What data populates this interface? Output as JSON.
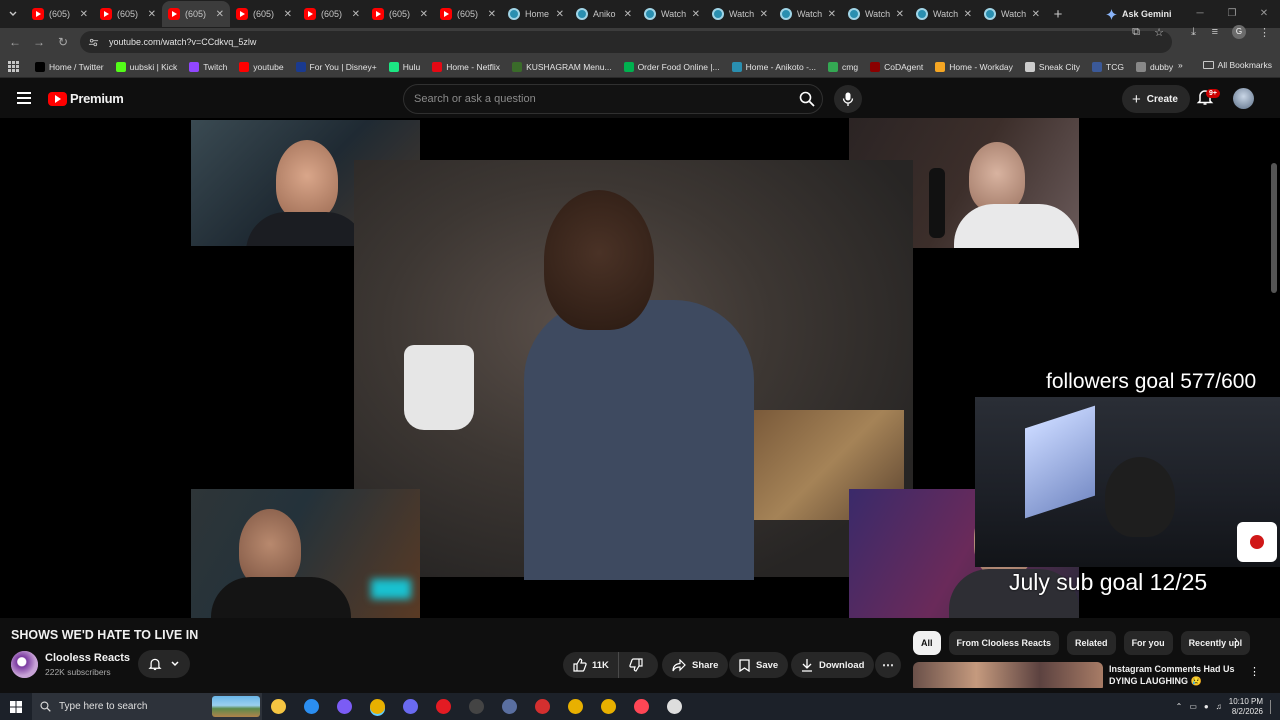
{
  "browser": {
    "tabs": [
      {
        "label": "(605)",
        "icon": "youtube-icon",
        "active": false
      },
      {
        "label": "(605)",
        "icon": "youtube-icon",
        "active": false
      },
      {
        "label": "(605)",
        "icon": "youtube-icon",
        "active": true
      },
      {
        "label": "(605)",
        "icon": "youtube-icon",
        "active": false
      },
      {
        "label": "(605)",
        "icon": "youtube-icon",
        "active": false
      },
      {
        "label": "(605)",
        "icon": "youtube-icon",
        "active": false
      },
      {
        "label": "(605)",
        "icon": "youtube-icon",
        "active": false
      },
      {
        "label": "Home",
        "icon": "globe-icon",
        "active": false
      },
      {
        "label": "Aniko",
        "icon": "globe-icon",
        "active": false
      },
      {
        "label": "Watch",
        "icon": "globe-icon",
        "active": false
      },
      {
        "label": "Watch",
        "icon": "globe-icon",
        "active": false
      },
      {
        "label": "Watch",
        "icon": "globe-icon",
        "active": false
      },
      {
        "label": "Watch",
        "icon": "globe-icon",
        "active": false
      },
      {
        "label": "Watch",
        "icon": "globe-icon",
        "active": false
      },
      {
        "label": "Watch",
        "icon": "globe-icon",
        "active": false
      }
    ],
    "ask_gemini": "Ask Gemini",
    "url": "youtube.com/watch?v=CCdkvq_5zlw",
    "bookmarks": [
      {
        "label": "Home / Twitter",
        "color": "#000000"
      },
      {
        "label": "uubski | Kick",
        "color": "#53fc18"
      },
      {
        "label": "Twitch",
        "color": "#9146ff"
      },
      {
        "label": "youtube",
        "color": "#ff0000"
      },
      {
        "label": "For You | Disney+",
        "color": "#1a3a8f"
      },
      {
        "label": "Hulu",
        "color": "#1ce783"
      },
      {
        "label": "Home - Netflix",
        "color": "#e50914"
      },
      {
        "label": "KUSHAGRAM Menu...",
        "color": "#3a6b2a"
      },
      {
        "label": "Order Food Online |...",
        "color": "#00b14f"
      },
      {
        "label": "Home - Anikoto -...",
        "color": "#2a8fb0"
      },
      {
        "label": "cmg",
        "color": "#34a853"
      },
      {
        "label": "CoDAgent",
        "color": "#8b0000"
      },
      {
        "label": "Home - Workday",
        "color": "#f5a623"
      },
      {
        "label": "Sneak City",
        "color": "#cccccc"
      },
      {
        "label": "TCG",
        "color": "#3b5998"
      },
      {
        "label": "dubby",
        "color": "#888888"
      }
    ],
    "all_bookmarks": "All Bookmarks",
    "profile_initial": "G"
  },
  "youtube": {
    "logo_word": "Premium",
    "search_placeholder": "Search or ask a question",
    "create_label": "Create",
    "notification_badge": "9+",
    "overlay_followers": "followers goal 577/600",
    "overlay_sub": "July sub goal 12/25",
    "video_title": "SHOWS WE'D HATE TO LIVE IN",
    "channel_name": "Clooless Reacts",
    "subscribers": "222K subscribers",
    "like_count": "11K",
    "share_label": "Share",
    "save_label": "Save",
    "download_label": "Download",
    "chips": [
      "All",
      "From Clooless Reacts",
      "Related",
      "For you",
      "Recently upl"
    ],
    "rec_title": "Instagram Comments Had Us DYING LAUGHING 😢"
  },
  "taskbar": {
    "search_placeholder": "Type here to search",
    "time": "10:10 PM",
    "date": "8/2/2026",
    "icons": [
      {
        "name": "file-explorer-icon",
        "color": "#f5c542"
      },
      {
        "name": "edge-icon",
        "color": "#2b8ef0"
      },
      {
        "name": "discord-icon",
        "color": "#7b5cf5"
      },
      {
        "name": "chrome-icon",
        "color": "#e8b000"
      },
      {
        "name": "gamepad-icon",
        "color": "#6a6af0"
      },
      {
        "name": "youtube-app-icon",
        "color": "#e31b23"
      },
      {
        "name": "obs-icon",
        "color": "#444444"
      },
      {
        "name": "steam-icon",
        "color": "#5a6fa0"
      },
      {
        "name": "app-red-icon",
        "color": "#d32f2f"
      },
      {
        "name": "chrome-2-icon",
        "color": "#e8b000"
      },
      {
        "name": "chrome-3-icon",
        "color": "#e8b000"
      },
      {
        "name": "valorant-icon",
        "color": "#ff4655"
      },
      {
        "name": "clock-app-icon",
        "color": "#dddddd"
      }
    ]
  }
}
